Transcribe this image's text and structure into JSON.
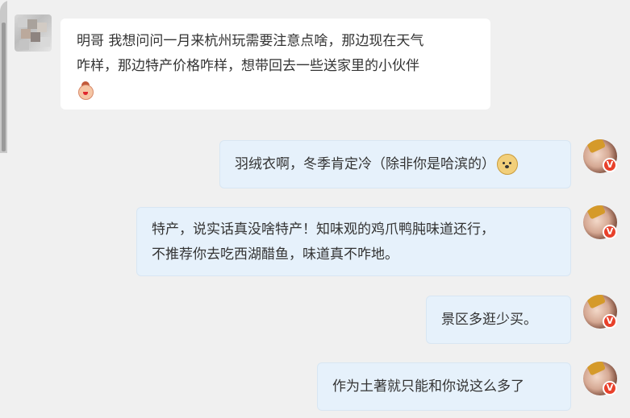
{
  "conversation": {
    "incoming": {
      "text_line1": "明哥 我想问问一月来杭州玩需要注意点啥，那边现在天气",
      "text_line2": "咋样，那边特产价格咋样，想带回去一些送家里的小伙伴",
      "emoji": "baby-face-emoji"
    },
    "outgoing": [
      {
        "text": "羽绒衣啊，冬季肯定冷（除非你是哈滨的）",
        "emoji": "doge-emoji"
      },
      {
        "line1": "特产，说实话真没啥特产！知味观的鸡爪鸭肫味道还行，",
        "line2": "不推荐你去吃西湖醋鱼，味道真不咋地。"
      },
      {
        "text": "景区多逛少买。"
      },
      {
        "text": "作为土著就只能和你说这么多了"
      }
    ],
    "badge_symbol": "V"
  },
  "colors": {
    "background": "#f0f0f0",
    "incoming_bubble": "#ffffff",
    "outgoing_bubble": "#e6f1fb",
    "badge": "#e8412b"
  }
}
